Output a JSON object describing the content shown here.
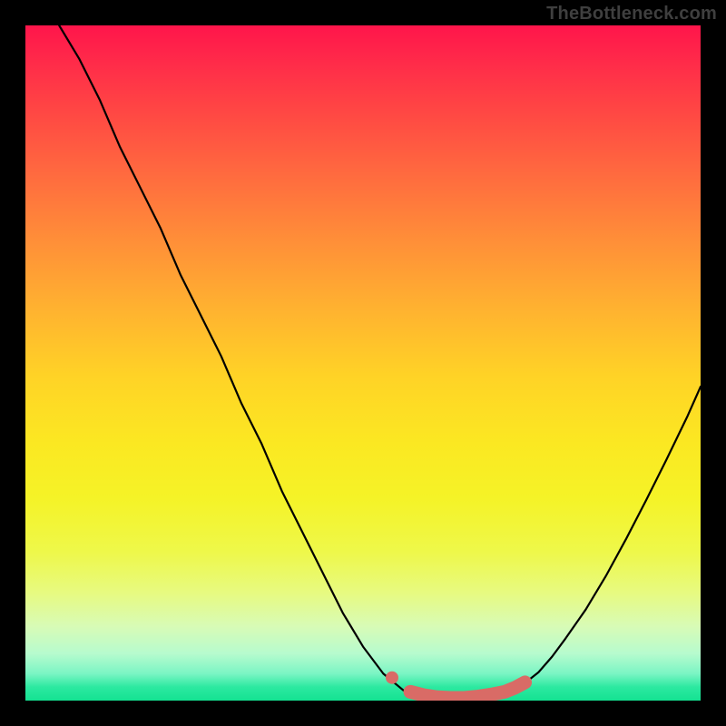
{
  "watermark": "TheBottleneck.com",
  "chart_data": {
    "type": "line",
    "title": "",
    "xlabel": "",
    "ylabel": "",
    "xlim": [
      0,
      100
    ],
    "ylim": [
      0,
      100
    ],
    "curve_points": [
      {
        "x": 5,
        "y": 100
      },
      {
        "x": 8,
        "y": 95
      },
      {
        "x": 11,
        "y": 89
      },
      {
        "x": 14,
        "y": 82
      },
      {
        "x": 17,
        "y": 76
      },
      {
        "x": 20,
        "y": 70
      },
      {
        "x": 23,
        "y": 63
      },
      {
        "x": 26,
        "y": 57
      },
      {
        "x": 29,
        "y": 51
      },
      {
        "x": 32,
        "y": 44
      },
      {
        "x": 35,
        "y": 38
      },
      {
        "x": 38,
        "y": 31
      },
      {
        "x": 41,
        "y": 25
      },
      {
        "x": 44,
        "y": 19
      },
      {
        "x": 47,
        "y": 13
      },
      {
        "x": 50,
        "y": 8
      },
      {
        "x": 53,
        "y": 4
      },
      {
        "x": 56,
        "y": 1.5
      },
      {
        "x": 58,
        "y": 0.8
      },
      {
        "x": 60,
        "y": 0.5
      },
      {
        "x": 62,
        "y": 0.4
      },
      {
        "x": 64,
        "y": 0.4
      },
      {
        "x": 66,
        "y": 0.5
      },
      {
        "x": 68,
        "y": 0.7
      },
      {
        "x": 70,
        "y": 1.0
      },
      {
        "x": 72,
        "y": 1.6
      },
      {
        "x": 74,
        "y": 2.6
      },
      {
        "x": 76,
        "y": 4.2
      },
      {
        "x": 78,
        "y": 6.5
      },
      {
        "x": 80,
        "y": 9.2
      },
      {
        "x": 83,
        "y": 13.5
      },
      {
        "x": 86,
        "y": 18.5
      },
      {
        "x": 89,
        "y": 24.0
      },
      {
        "x": 92,
        "y": 29.8
      },
      {
        "x": 95,
        "y": 35.8
      },
      {
        "x": 98,
        "y": 42.0
      },
      {
        "x": 100,
        "y": 46.5
      }
    ],
    "highlight_segment": [
      {
        "x": 57,
        "y": 1.3
      },
      {
        "x": 59,
        "y": 0.8
      },
      {
        "x": 61,
        "y": 0.5
      },
      {
        "x": 63,
        "y": 0.4
      },
      {
        "x": 65,
        "y": 0.4
      },
      {
        "x": 67,
        "y": 0.6
      },
      {
        "x": 69,
        "y": 0.9
      },
      {
        "x": 71,
        "y": 1.3
      },
      {
        "x": 72.5,
        "y": 1.9
      },
      {
        "x": 74,
        "y": 2.7
      }
    ],
    "highlight_dot": {
      "x": 54.3,
      "y": 3.4
    },
    "gradient_stops": [
      {
        "pos": 0,
        "color": "#ff154b"
      },
      {
        "pos": 25,
        "color": "#ff7a3c"
      },
      {
        "pos": 50,
        "color": "#ffd028"
      },
      {
        "pos": 75,
        "color": "#f0f63a"
      },
      {
        "pos": 100,
        "color": "#14e292"
      }
    ]
  }
}
